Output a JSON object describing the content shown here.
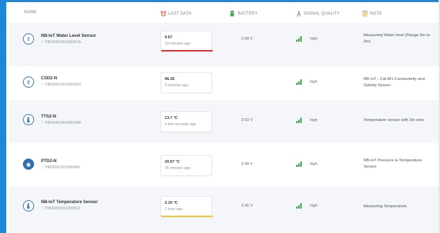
{
  "header": {
    "name": "NAME",
    "last_data": "LAST DATA",
    "battery": "BATTERY",
    "signal_quality": "SIGNAL QUALITY",
    "note": "NOTE"
  },
  "colors": {
    "frame": "#1e88d8",
    "signal": "#3aa845",
    "alert_red": "#e02424",
    "alert_yellow": "#f2c12e"
  },
  "rows": [
    {
      "icon": "water-level-icon",
      "name": "NB-IoT Water Level Sensor",
      "serial": "70B3D5CD01000A7A",
      "value": "9.67",
      "ago": "33 minutes ago",
      "status_bar": "red",
      "battery": "3.58 V",
      "signal": "high",
      "note": "Measuring Water level (Range 0m to 3m)"
    },
    {
      "icon": "conductivity-icon",
      "name": "CSD2-N",
      "serial": "70B3D5CD010009D4",
      "value": "96.35",
      "ago": "9 minutes ago",
      "status_bar": "",
      "battery": "",
      "signal": "high",
      "note": "NB IoT - Cat-M1 Conductivity and Salinity Sensor"
    },
    {
      "icon": "thermometer-icon",
      "name": "TTS2-N",
      "serial": "70B3D5CD010009AB",
      "value": "13.7 °C",
      "ago": "a few seconds ago",
      "status_bar": "",
      "battery": "3.53 V",
      "signal": "high",
      "note": "Temperature sensor with 3m wire"
    },
    {
      "icon": "pressure-icon",
      "name": "PTD2-N",
      "serial": "70B3D5CD0100068F",
      "value": "20.67 °C",
      "ago": "35 minutes ago",
      "status_bar": "",
      "battery": "3.49 V",
      "signal": "high",
      "note": "NB-IoT Pressure & Temperature Sensor"
    },
    {
      "icon": "thermometer-icon",
      "name": "NB-IoT Temperature Sensor",
      "serial": "70B3D5CD010005F2",
      "value": "2.19 °C",
      "ago": "1 hour ago",
      "status_bar": "yellow",
      "battery": "3.45 V",
      "signal": "high",
      "note": "Measuring Temperature"
    }
  ]
}
